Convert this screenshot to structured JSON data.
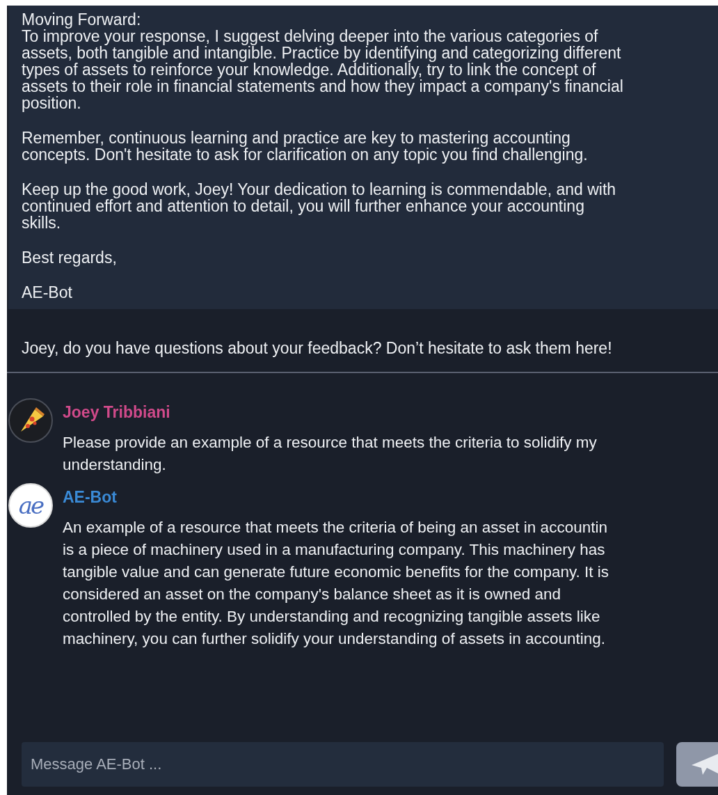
{
  "feedback_card": {
    "paragraphs": [
      [
        "Moving Forward:",
        "To improve your response, I suggest delving deeper into the various categories of",
        "assets, both tangible and intangible. Practice by identifying and categorizing different",
        "types of assets to reinforce your knowledge. Additionally, try to link the concept of",
        "assets to their role in financial statements and how they impact a company's financial",
        "position."
      ],
      [
        "Remember, continuous learning and practice are key to mastering accounting",
        "concepts. Don't hesitate to ask for clarification on any topic you find challenging."
      ],
      [
        "Keep up the good work, Joey! Your dedication to learning is commendable, and with",
        "continued effort and attention to detail, you will further enhance your accounting",
        "skills."
      ],
      [
        "Best regards,"
      ],
      [
        "AE-Bot"
      ]
    ]
  },
  "prompt": "Joey, do you have questions about your feedback? Don’t hesitate to ask them here!",
  "messages": [
    {
      "kind": "user",
      "author": "Joey Tribbiani",
      "color": "#d04a8a",
      "lines": [
        "Please provide an example of a resource that meets the criteria to solidify my",
        "understanding."
      ]
    },
    {
      "kind": "bot",
      "author": "AE-Bot",
      "color": "#3a8ad6",
      "logo_text": "ae",
      "lines": [
        "An example of a resource that meets the criteria of being an asset in accountin",
        "is a piece of machinery used in a manufacturing company. This machinery has",
        "tangible value and can generate future economic benefits for the company. It is",
        "considered an asset on the company's balance sheet as it is owned and",
        "controlled by the entity. By understanding and recognizing tangible assets like",
        "machinery, you can further solidify your understanding of assets in accounting."
      ]
    }
  ],
  "composer": {
    "placeholder": "Message AE-Bot ..."
  }
}
